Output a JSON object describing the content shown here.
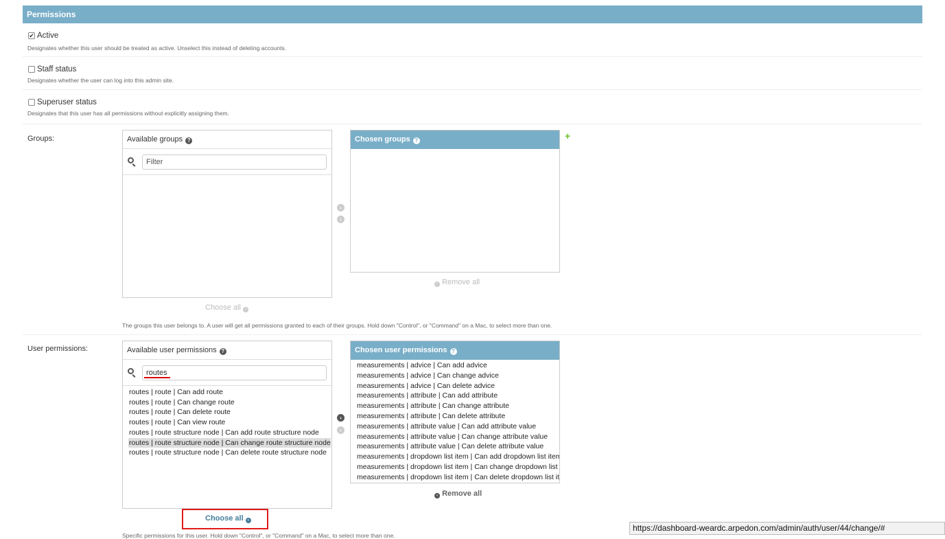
{
  "module": {
    "title": "Permissions"
  },
  "fields": {
    "active": {
      "label": "Active",
      "checked": true,
      "help": "Designates whether this user should be treated as active. Unselect this instead of deleting accounts."
    },
    "staff": {
      "label": "Staff status",
      "checked": false,
      "help": "Designates whether the user can log into this admin site."
    },
    "superuser": {
      "label": "Superuser status",
      "checked": false,
      "help": "Designates that this user has all permissions without explicitly assigning them."
    }
  },
  "groups": {
    "label": "Groups:",
    "available_title": "Available groups",
    "chosen_title": "Chosen groups",
    "filter_placeholder": "Filter",
    "filter_value": "",
    "choose_all": "Choose all",
    "remove_all": "Remove all",
    "help": "The groups this user belongs to. A user will get all permissions granted to each of their groups. Hold down \"Control\", or \"Command\" on a Mac, to select more than one.",
    "available": [],
    "chosen": []
  },
  "user_permissions": {
    "label": "User permissions:",
    "available_title": "Available user permissions",
    "chosen_title": "Chosen user permissions",
    "filter_value": "routes",
    "choose_all": "Choose all",
    "remove_all": "Remove all",
    "help": "Specific permissions for this user. Hold down \"Control\", or \"Command\" on a Mac, to select more than one.",
    "available": [
      "routes | route | Can add route",
      "routes | route | Can change route",
      "routes | route | Can delete route",
      "routes | route | Can view route",
      "routes | route structure node | Can add route structure node",
      "routes | route structure node | Can change route structure node",
      "routes | route structure node | Can delete route structure node"
    ],
    "selected_index": 5,
    "chosen": [
      "measurements | advice | Can add advice",
      "measurements | advice | Can change advice",
      "measurements | advice | Can delete advice",
      "measurements | attribute | Can add attribute",
      "measurements | attribute | Can change attribute",
      "measurements | attribute | Can delete attribute",
      "measurements | attribute value | Can add attribute value",
      "measurements | attribute value | Can change attribute value",
      "measurements | attribute value | Can delete attribute value",
      "measurements | dropdown list item | Can add dropdown list item",
      "measurements | dropdown list item | Can change dropdown list item",
      "measurements | dropdown list item | Can delete dropdown list item"
    ]
  },
  "status_bar": {
    "url": "https://dashboard-weardc.arpedon.com/admin/auth/user/44/change/#"
  },
  "icons": {
    "help": "question-circle-icon",
    "search": "search-icon",
    "add": "plus-icon",
    "move_right": "arrow-right-circle-icon",
    "move_left": "arrow-left-circle-icon"
  },
  "colors": {
    "header": "#79aec8",
    "link": "#447e9b",
    "add": "#70bf2b",
    "highlight": "#e01a1a"
  }
}
